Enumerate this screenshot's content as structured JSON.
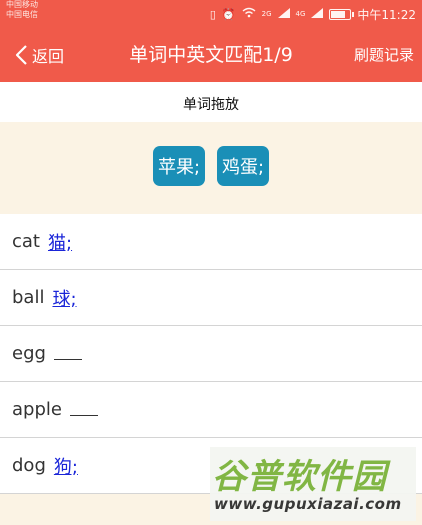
{
  "status_bar": {
    "carrier_line1": "中国移动",
    "carrier_line2": "中国电信",
    "time": "中午11:22",
    "signal_tag_1": "2G",
    "signal_tag_2": "4G"
  },
  "nav": {
    "back_label": "返回",
    "title": "单词中英文匹配1/9",
    "history_label": "刷题记录"
  },
  "section": {
    "title": "单词拖放"
  },
  "pool": {
    "chips": [
      "苹果;",
      "鸡蛋;"
    ]
  },
  "rows": [
    {
      "english": "cat",
      "answer": "猫;"
    },
    {
      "english": "ball",
      "answer": "球;"
    },
    {
      "english": "egg",
      "answer": ""
    },
    {
      "english": "apple",
      "answer": ""
    },
    {
      "english": "dog",
      "answer": "狗;"
    }
  ],
  "watermark": {
    "title": "谷普软件园",
    "url": "www.gupuxiazai.com"
  },
  "colors": {
    "accent": "#f05a4a",
    "chip": "#1a8fb7",
    "link": "#1a25d8",
    "pool_bg": "#fbf3e4"
  },
  "icons": [
    "back-chevron-icon",
    "notification-icon",
    "alarm-icon",
    "wifi-icon",
    "signal-icon",
    "battery-icon"
  ]
}
